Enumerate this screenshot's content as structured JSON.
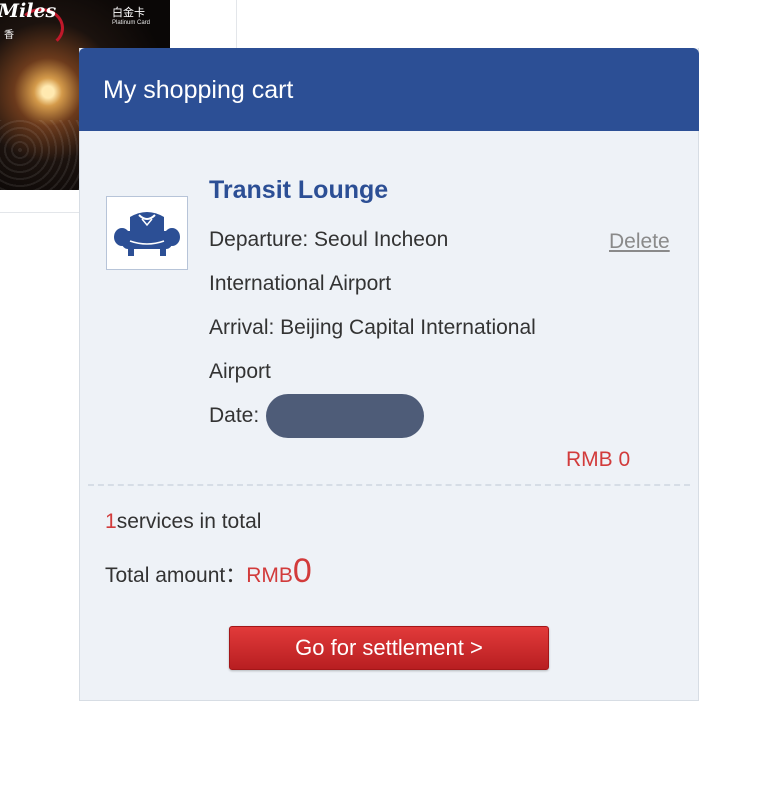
{
  "background_card": {
    "brand": "Miles",
    "chinese_small": "香",
    "chinese_label": "白金卡",
    "english_label": "Platinum Card"
  },
  "cart": {
    "title": "My shopping cart",
    "item": {
      "icon": "armchair-icon",
      "name": "Transit Lounge",
      "departure_line1": "Departure: Seoul Incheon",
      "departure_line2": "International Airport",
      "arrival_line1": "Arrival: Beijing Capital International",
      "arrival_line2": "Airport",
      "date_label": "Date:",
      "delete_label": "Delete",
      "price": "RMB 0"
    },
    "summary": {
      "count": "1",
      "count_suffix": "services in total",
      "total_label": "Total amount：",
      "total_currency": "RMB",
      "total_value": "0"
    },
    "settle_button": "Go for settlement >"
  },
  "colors": {
    "header_blue": "#2c4f95",
    "price_red": "#d23b3b",
    "button_red": "#c8272a",
    "panel_bg": "#eef2f7"
  }
}
